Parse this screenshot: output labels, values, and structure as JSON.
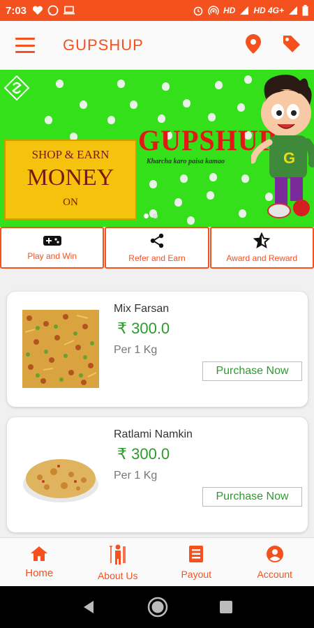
{
  "status_bar": {
    "time": "7:03",
    "network": "HD",
    "network2": "HD 4G+"
  },
  "app_bar": {
    "title": "GUPSHUP",
    "icons": [
      "menu-icon",
      "location-pin-icon",
      "tag-icon"
    ],
    "accent_color": "#f4511e"
  },
  "banner": {
    "shop_line1": "SHOP & EARN",
    "shop_line2": "MONEY",
    "shop_line3": "ON",
    "brand": "GUPSHUP",
    "tagline": "Kharcha karo paisa kamao",
    "background_color": "#33e01a"
  },
  "features": [
    {
      "label": "Play and Win",
      "icon": "gamepad-icon"
    },
    {
      "label": "Refer and Earn",
      "icon": "share-icon"
    },
    {
      "label": "Award and Reward",
      "icon": "star-award-icon"
    }
  ],
  "products": [
    {
      "name": "Mix Farsan",
      "price": "₹ 300.0",
      "unit": "Per 1 Kg",
      "button": "Purchase Now"
    },
    {
      "name": "Ratlami Namkin",
      "price": "₹ 300.0",
      "unit": "Per 1 Kg",
      "button": "Purchase Now"
    }
  ],
  "bottom_nav": [
    {
      "label": "Home",
      "icon": "home-icon",
      "active": true
    },
    {
      "label": "About Us",
      "icon": "person-icon",
      "active": false
    },
    {
      "label": "Payout",
      "icon": "receipt-icon",
      "active": false
    },
    {
      "label": "Account",
      "icon": "account-circle-icon",
      "active": false
    }
  ],
  "price_color": "#2e9a2e"
}
